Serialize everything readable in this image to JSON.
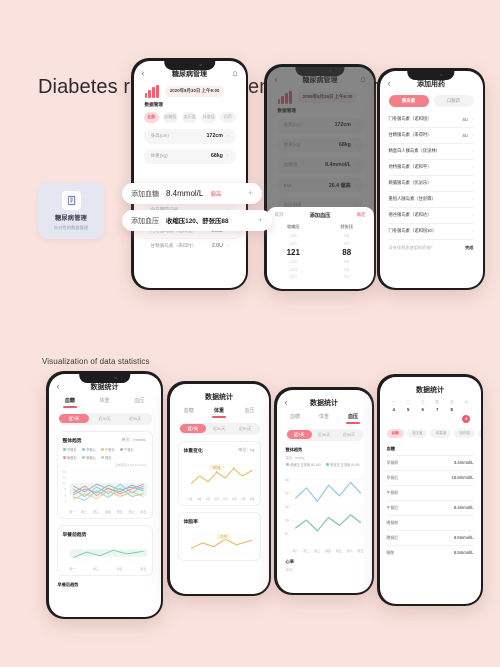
{
  "page": {
    "background": "#fae3de",
    "headline": "Diabetes record management function",
    "section_label": "Visualization of data statistics",
    "accent": "#ef5a6a",
    "accent_soft": "#f27f89"
  },
  "badge": {
    "icon": "clipboard-icon",
    "title": "糖尿病管理",
    "subtitle": "针对性的数据管理"
  },
  "phone1": {
    "nav": {
      "back": "‹",
      "title": "糖尿病管理",
      "bell": "bell-icon"
    },
    "date": "2020年8月30日 上午9:00",
    "section": "数据管理",
    "chips": [
      "全部",
      "血糖值",
      "血压值",
      "体重值",
      "用药"
    ],
    "chip_active": 0,
    "rows": [
      {
        "label": "身高(cm)",
        "value": "172cm"
      },
      {
        "label": "体重(kg)",
        "value": "68kg"
      }
    ],
    "med_section": "今日用药记录",
    "med_rows": [
      {
        "label": "门冬胰岛素（诺和锐）",
        "value": "2.0U"
      },
      {
        "label": "甘精胰岛素（来得时）",
        "value": "2.0U"
      }
    ],
    "pill_glucose": {
      "label": "添加血糖",
      "value": "8.4mmol/L",
      "warn": "偏高",
      "plus": "+"
    },
    "pill_pressure": {
      "label": "添加血压",
      "value": "收缩压120、舒张压88",
      "plus": "+"
    }
  },
  "phone2": {
    "nav": {
      "back": "‹",
      "title": "糖尿病管理",
      "bell": "bell-icon"
    },
    "date": "2009年8月26日 上午9:00",
    "section": "数据管理",
    "rows": [
      {
        "label": "身高(cm)",
        "value": "172cm"
      },
      {
        "label": "体重(kg)",
        "value": "68kg"
      },
      {
        "label": "血糖值",
        "value": "8.4mmol/L"
      },
      {
        "label": "BMI",
        "value": "26.4 偏高"
      },
      {
        "label": "血压血氧",
        "value": ""
      },
      {
        "label": "运动管理",
        "value": ""
      }
    ],
    "sheet": {
      "cancel": "取消",
      "title": "添加血压",
      "confirm": "确定",
      "columns": [
        {
          "header": "收缩压",
          "values": [
            "118",
            "120",
            "121",
            "122",
            "123",
            "124"
          ],
          "selected_index": 2
        },
        {
          "header": "舒张压",
          "values": [
            "86",
            "87",
            "88",
            "89",
            "90",
            "91"
          ],
          "selected_index": 2
        }
      ]
    }
  },
  "phone3": {
    "nav": {
      "back": "‹",
      "title": "添加用药",
      "bell": "bell-icon"
    },
    "tabs": [
      "胰岛素",
      "口服药"
    ],
    "tab_active": 0,
    "items": [
      {
        "label": "门冬胰岛素（诺和锐）",
        "unit": "8U"
      },
      {
        "label": "甘精胰岛素（来得时）",
        "unit": "8U"
      },
      {
        "label": "精蛋白人胰岛素（优泌林）",
        "unit": ""
      },
      {
        "label": "地特胰岛素（诺和平）",
        "unit": ""
      },
      {
        "label": "赖脯胰岛素（优泌乐）",
        "unit": ""
      },
      {
        "label": "重组人胰岛素（甘舒霖）",
        "unit": ""
      },
      {
        "label": "德谷胰岛素（诺和达）",
        "unit": ""
      },
      {
        "label": "门冬胰岛素（诺和锐30）",
        "unit": ""
      }
    ],
    "footer_hint": "没有找到您使用的药物？",
    "footer_action": "完成"
  },
  "phone4": {
    "nav": {
      "back": "‹",
      "title": "数据统计"
    },
    "tabs": [
      "血糖",
      "体重",
      "血压"
    ],
    "tab_active": 0,
    "segments": [
      "近7天",
      "近30天",
      "近90天"
    ],
    "segment_active": 0,
    "panel1": {
      "title": "整体趋势",
      "right": "单位：mmol/L",
      "legend": [
        {
          "name": "早餐前",
          "color": "#7fc8a9"
        },
        {
          "name": "早餐后",
          "color": "#8ec6e8"
        },
        {
          "name": "午餐前",
          "color": "#f4c37d"
        },
        {
          "name": "午餐后",
          "color": "#b3a4dd"
        },
        {
          "name": "晚餐前",
          "color": "#f08f9c"
        },
        {
          "name": "晚餐后",
          "color": "#9ad4c4"
        },
        {
          "name": "睡前",
          "color": "#c9c9ce"
        }
      ],
      "note": "正常范围 3.9-6.1mmol/L",
      "xticks": [
        "周一",
        "周二",
        "周三",
        "周四",
        "周五",
        "周六",
        "周日"
      ],
      "yticks": [
        "16",
        "12",
        "10",
        "8",
        "6",
        "4",
        "2"
      ]
    },
    "panel2": {
      "title": "早餐前趋势",
      "xticks": [
        "周一",
        "周三",
        "周五",
        "周日"
      ]
    },
    "panel3": {
      "title": "早餐后趋势"
    }
  },
  "phone5": {
    "nav": {
      "title": "数据统计"
    },
    "tabs": [
      "血糖",
      "体重",
      "血压"
    ],
    "tab_active": 1,
    "segments": [
      "近7天",
      "近30天",
      "近90天"
    ],
    "segment_active": 0,
    "panel1": {
      "title": "体重变化",
      "note": "单位：kg",
      "badge": "68.2kg",
      "xticks": [
        "1月",
        "2月",
        "3月",
        "4月",
        "5月",
        "6月",
        "7月",
        "8月"
      ]
    },
    "panel2": {
      "title": "体脂率",
      "badge": "22.4%"
    }
  },
  "phone6": {
    "nav": {
      "back": "‹",
      "title": "数据统计"
    },
    "tabs": [
      "血糖",
      "体重",
      "血压"
    ],
    "tab_active": 2,
    "segments": [
      "近7天",
      "近30天",
      "近90天"
    ],
    "segment_active": 0,
    "panel1": {
      "title": "整体趋势",
      "sub": "单位：mmHg",
      "legend": [
        {
          "name": "收缩压 正常值 90-140",
          "color": "#8ec6e8"
        },
        {
          "name": "舒张压 正常值 60-90",
          "color": "#7fc8a9"
        }
      ],
      "xticks": [
        "周一",
        "周二",
        "周三",
        "周四",
        "周五",
        "周六",
        "周日"
      ]
    },
    "panel2": {
      "title": "心率",
      "note": "次/分"
    }
  },
  "phone7": {
    "nav": {
      "title": "数据统计"
    },
    "calendar": {
      "weekdays": [
        "一",
        "二",
        "三",
        "四",
        "五",
        "六"
      ],
      "days": [
        "4",
        "5",
        "6",
        "7",
        "8",
        "9"
      ],
      "selected_index": 5
    },
    "filters": [
      "血糖",
      "血压值",
      "体重值",
      "用药量",
      "心率"
    ],
    "filter_active": 0,
    "list_header": "血糖",
    "rows": [
      {
        "label": "早餐前",
        "value": "3.4mmol/L"
      },
      {
        "label": "早餐后",
        "value": "15.6mmol/L"
      },
      {
        "label": "午餐前",
        "value": ""
      },
      {
        "label": "午餐后",
        "value": "8.4mmol/L"
      },
      {
        "label": "晚餐前",
        "value": ""
      },
      {
        "label": "晚餐后",
        "value": "6.5mmol/L"
      },
      {
        "label": "睡前",
        "value": "6.5mmol/L"
      }
    ]
  }
}
